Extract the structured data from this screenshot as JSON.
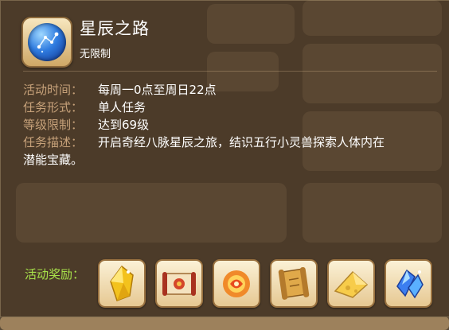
{
  "activity": {
    "title": "星辰之路",
    "limit": "无限制",
    "icon": "star-orb-icon"
  },
  "details": [
    {
      "key": "活动时间：",
      "value": "每周一0点至周日22点"
    },
    {
      "key": "任务形式：",
      "value": "单人任务"
    },
    {
      "key": "等级限制：",
      "value": "达到69级"
    }
  ],
  "description": {
    "key": "任务描述：",
    "line1": "开启奇经八脉星辰之旅，结识五行小灵兽探索人体内在",
    "line2": "潜能宝藏。"
  },
  "rewards": {
    "label": "活动奖励：",
    "items": [
      {
        "icon": "gold-crystal-icon"
      },
      {
        "icon": "red-scroll-icon"
      },
      {
        "icon": "fire-orb-icon"
      },
      {
        "icon": "treasure-map-icon"
      },
      {
        "icon": "cheese-stone-icon"
      },
      {
        "icon": "blue-crystal-icon"
      }
    ]
  },
  "colors": {
    "key_text": "#c7a27a",
    "reward_label": "#a8e24a",
    "value_text": "#ffffff"
  }
}
